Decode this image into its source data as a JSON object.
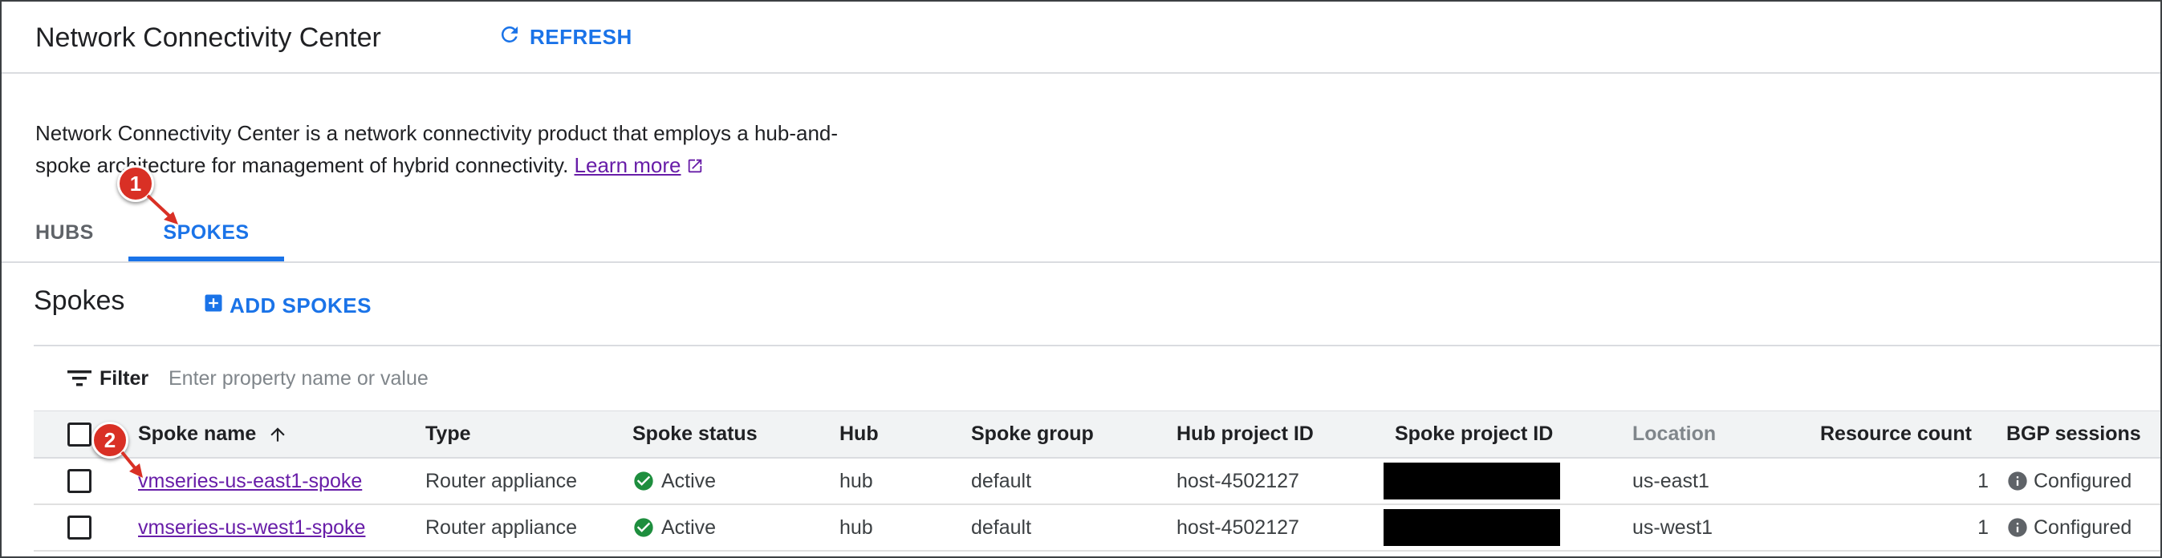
{
  "header": {
    "title": "Network Connectivity Center",
    "refresh_label": "REFRESH"
  },
  "description": {
    "line1": "Network Connectivity Center is a network connectivity product that employs a hub-and-",
    "line2": "spoke architecture for management of hybrid connectivity.",
    "learn_more": "Learn more"
  },
  "tabs": [
    {
      "label": "HUBS",
      "selected": false
    },
    {
      "label": "SPOKES",
      "selected": true
    }
  ],
  "section": {
    "title": "Spokes",
    "add_label": "ADD SPOKES"
  },
  "filter": {
    "label": "Filter",
    "placeholder": "Enter property name or value"
  },
  "table": {
    "columns": [
      "Spoke name",
      "Type",
      "Spoke status",
      "Hub",
      "Spoke group",
      "Hub project ID",
      "Spoke project ID",
      "Location",
      "Resource count",
      "BGP sessions"
    ],
    "rows": [
      {
        "name": "vmseries-us-east1-spoke",
        "type": "Router appliance",
        "status": "Active",
        "hub": "hub",
        "group": "default",
        "hub_project": "host-4502127",
        "location": "us-east1",
        "resource_count": "1",
        "bgp": "Configured"
      },
      {
        "name": "vmseries-us-west1-spoke",
        "type": "Router appliance",
        "status": "Active",
        "hub": "hub",
        "group": "default",
        "hub_project": "host-4502127",
        "location": "us-west1",
        "resource_count": "1",
        "bgp": "Configured"
      }
    ]
  },
  "callouts": [
    "1",
    "2"
  ],
  "colors": {
    "accent": "#1a73e8",
    "link_visited": "#681da8",
    "success": "#1e8e3e",
    "callout": "#d93025"
  },
  "icons": {
    "refresh": "refresh-icon",
    "add": "add-box-icon",
    "filter": "filter-icon",
    "sort": "arrow-up-icon",
    "status": "check-circle-icon",
    "info": "info-icon",
    "external": "external-link-icon"
  }
}
